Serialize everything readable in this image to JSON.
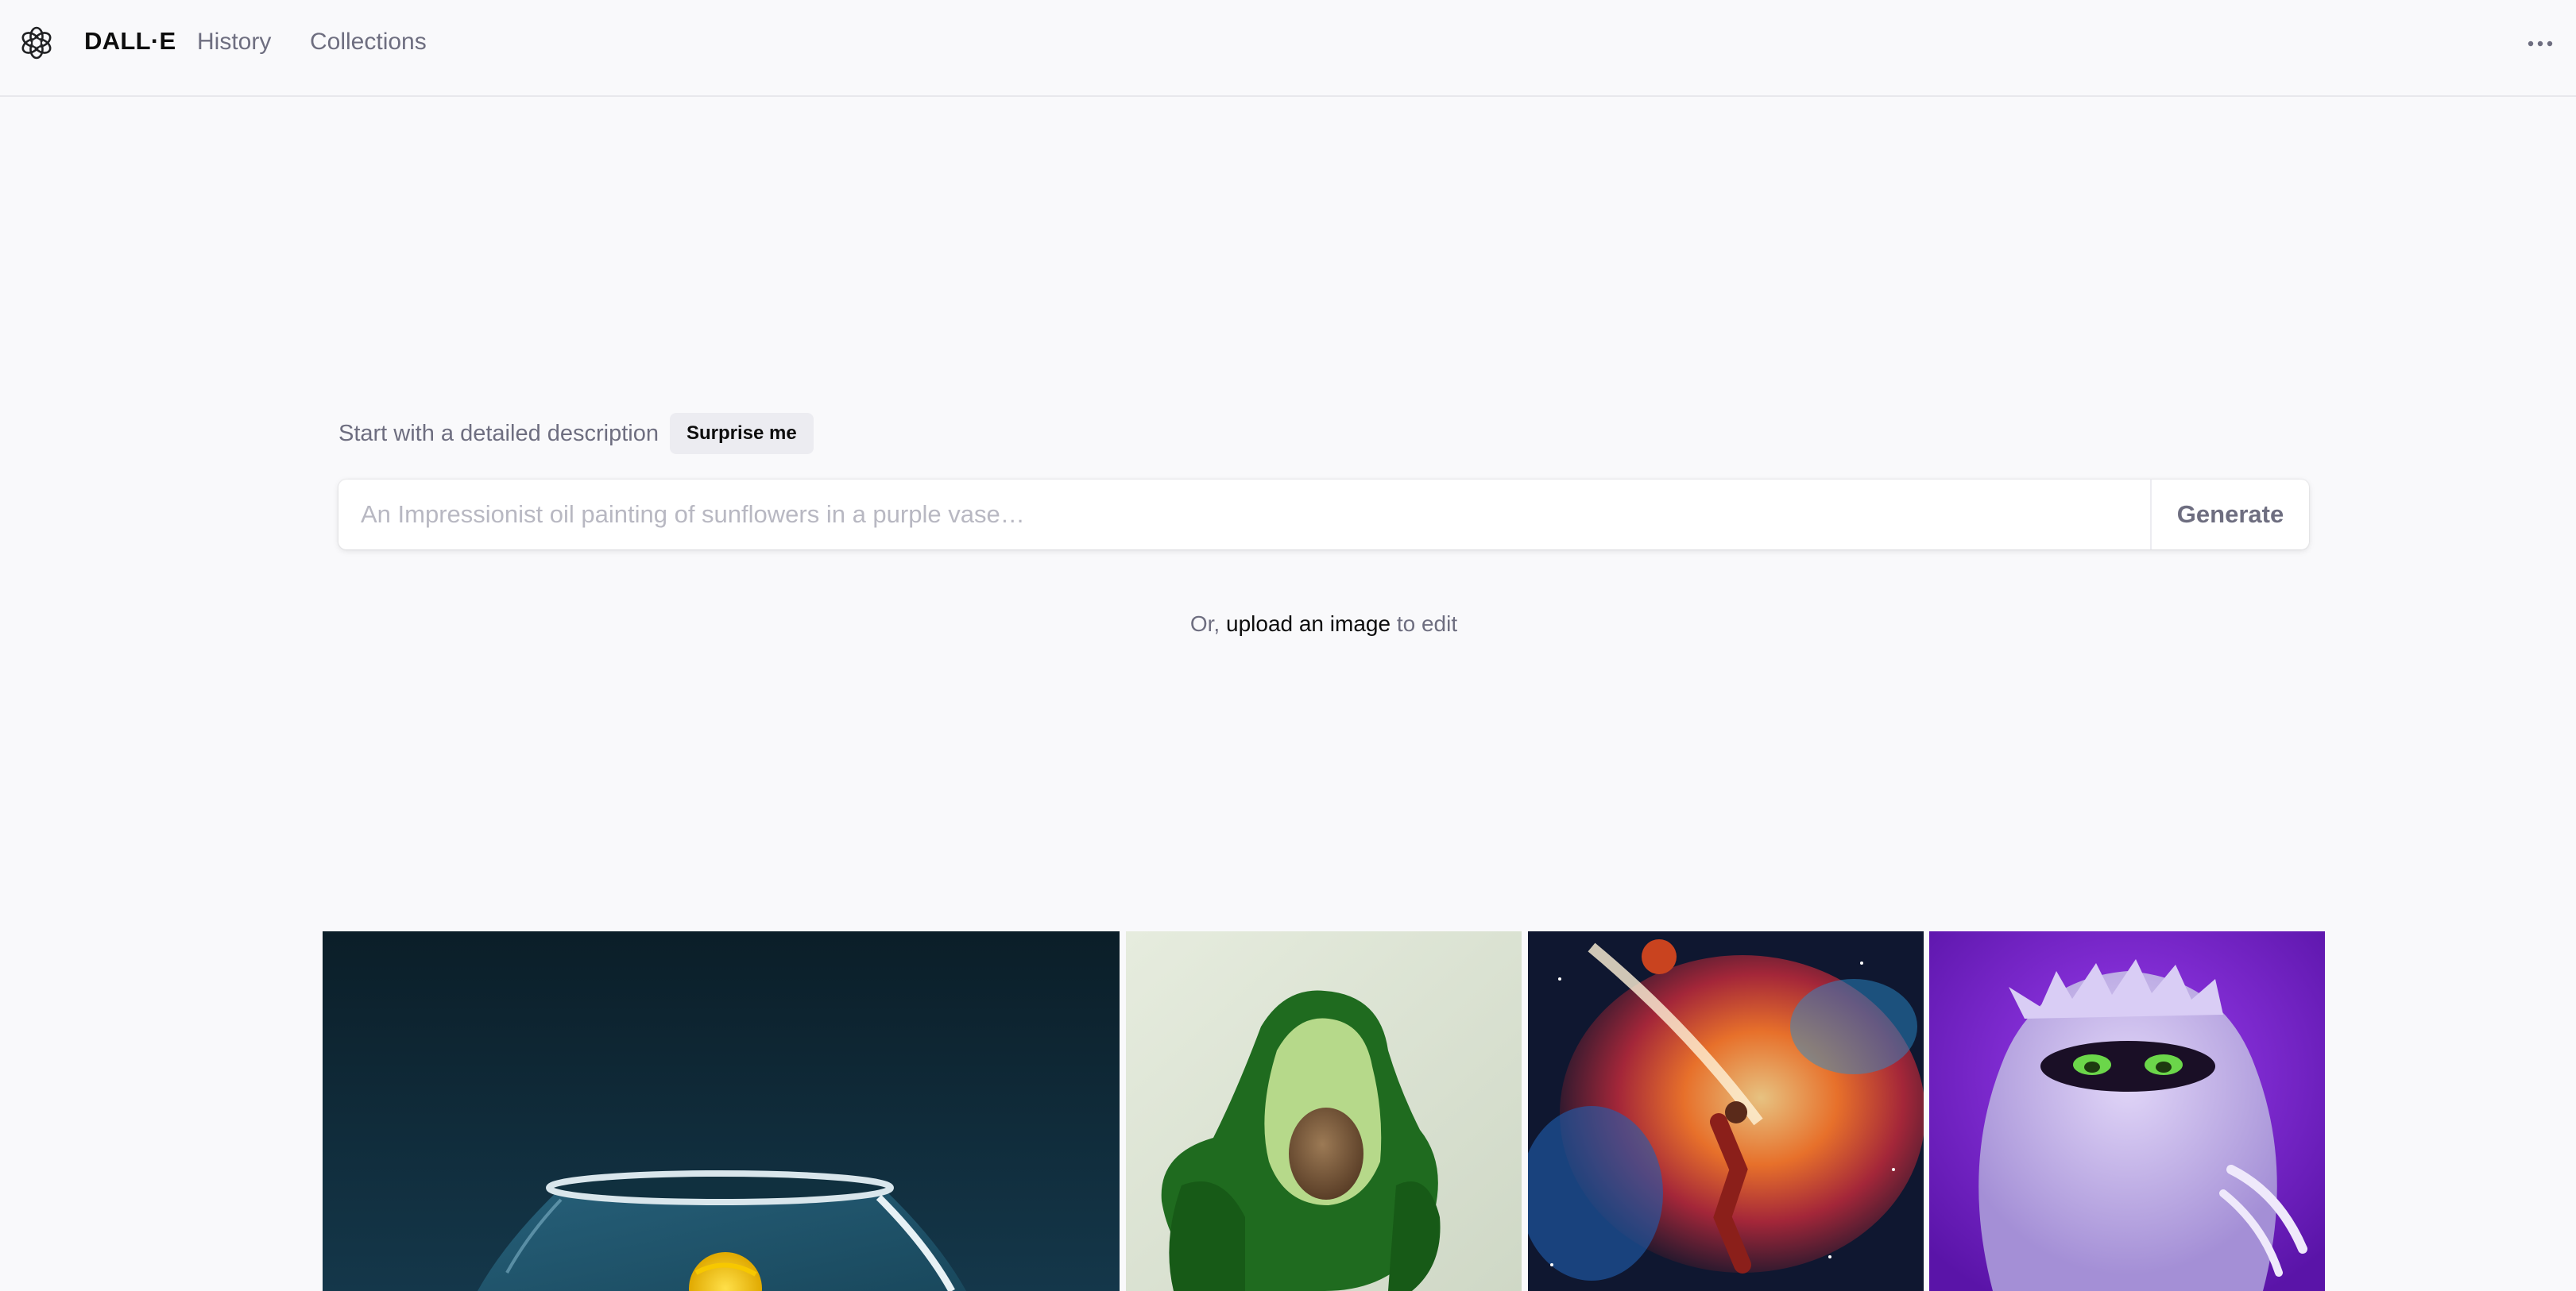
{
  "header": {
    "brand": "DALL·E",
    "nav": [
      {
        "label": "History"
      },
      {
        "label": "Collections"
      }
    ],
    "icons": {
      "logo": "openai-logo-icon",
      "more": "more-horizontal-icon"
    }
  },
  "prompt": {
    "hint": "Start with a detailed description",
    "surprise_label": "Surprise me",
    "input_value": "",
    "placeholder": "An Impressionist oil painting of sunflowers in a purple vase…",
    "generate_label": "Generate"
  },
  "upload": {
    "prefix": "Or,",
    "link": "upload an image",
    "suffix": "to edit"
  },
  "gallery": {
    "items": [
      {
        "subject": "fishbowl"
      },
      {
        "subject": "avocado-armchair"
      },
      {
        "subject": "space-basketball-painting"
      },
      {
        "subject": "purple-furry-monster"
      }
    ]
  },
  "colors": {
    "background": "#f9f9fb",
    "text_primary": "#0d0d0d",
    "text_muted": "#6e6e80",
    "surprise_bg": "#ececf1"
  }
}
